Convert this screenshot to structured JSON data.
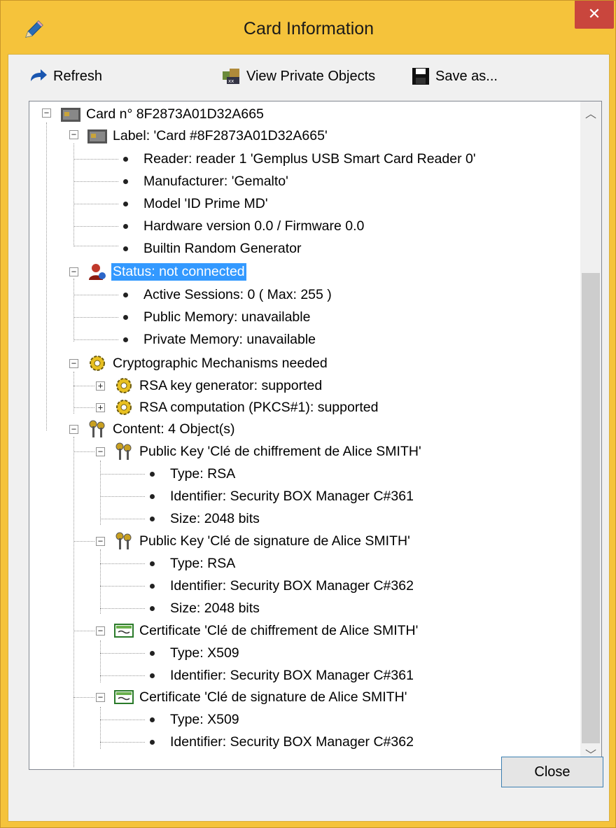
{
  "window": {
    "title": "Card Information",
    "close_glyph": "✕",
    "app_icon": "pencil-icon"
  },
  "toolbar": {
    "refresh_label": "Refresh",
    "view_private_label": "View Private Objects",
    "save_as_label": "Save as..."
  },
  "tree": {
    "card": "Card n° 8F2873A01D32A665",
    "label": "Label: 'Card #8F2873A01D32A665'",
    "reader": "Reader: reader 1  'Gemplus USB Smart Card Reader 0'",
    "manufacturer": "Manufacturer: 'Gemalto'",
    "model": "Model 'ID Prime MD'",
    "hardware": "Hardware version 0.0 / Firmware 0.0",
    "random": "Builtin Random Generator",
    "status": "Status: not connected",
    "sessions": "Active Sessions: 0  ( Max:  255 )",
    "public_mem": "Public Memory: unavailable",
    "private_mem": "Private Memory: unavailable",
    "crypto": "Cryptographic Mechanisms needed",
    "rsa_gen": "RSA key generator: supported",
    "rsa_comp": "RSA computation (PKCS#1): supported",
    "content": "Content:  4 Object(s)",
    "pk1": "Public Key 'Clé de chiffrement de Alice SMITH'",
    "pk1_type": "Type: RSA",
    "pk1_id": "Identifier: Security BOX Manager C#361",
    "pk1_size": "Size: 2048 bits",
    "pk2": "Public Key 'Clé de signature de Alice SMITH'",
    "pk2_type": "Type: RSA",
    "pk2_id": "Identifier: Security BOX Manager C#362",
    "pk2_size": "Size: 2048 bits",
    "cert1": "Certificate 'Clé de chiffrement de Alice SMITH'",
    "cert1_type": "Type: X509",
    "cert1_id": "Identifier: Security BOX Manager C#361",
    "cert2": "Certificate 'Clé de signature de Alice SMITH'",
    "cert2_type": "Type: X509",
    "cert2_id": "Identifier: Security BOX Manager C#362"
  },
  "buttons": {
    "close_label": "Close"
  },
  "colors": {
    "title_bar": "#f5c33b",
    "close_red": "#c9463d",
    "selection": "#3399ff"
  }
}
